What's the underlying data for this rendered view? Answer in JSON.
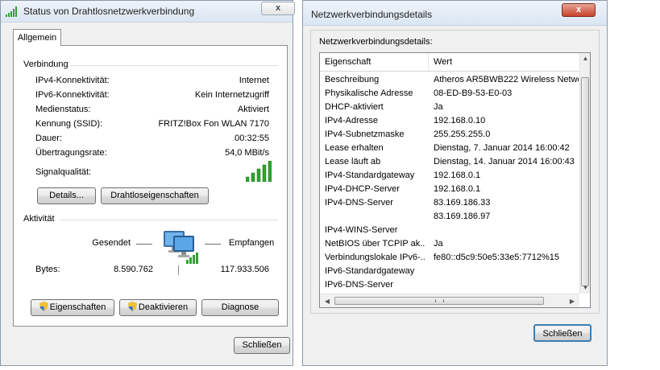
{
  "status_window": {
    "title": "Status von Drahtlosnetzwerkverbindung",
    "close_glyph": "x",
    "tab": "Allgemein",
    "connection_group": "Verbindung",
    "rows": [
      {
        "label": "IPv4-Konnektivität:",
        "value": "Internet"
      },
      {
        "label": "IPv6-Konnektivität:",
        "value": "Kein Internetzugriff"
      },
      {
        "label": "Medienstatus:",
        "value": "Aktiviert"
      },
      {
        "label": "Kennung (SSID):",
        "value": "FRITZ!Box Fon WLAN 7170"
      },
      {
        "label": "Dauer:",
        "value": "00:32:55"
      },
      {
        "label": "Übertragungsrate:",
        "value": "54,0 MBit/s"
      }
    ],
    "signal_label": "Signalqualität:",
    "signal_bars_lit": 5,
    "signal_bars_total": 5,
    "details_button": "Details...",
    "wireless_props_button": "Drahtloseigenschaften",
    "activity_group": "Aktivität",
    "sent_label": "Gesendet",
    "received_label": "Empfangen",
    "bytes_label": "Bytes:",
    "bytes_sent": "8.590.762",
    "bytes_received": "117.933.506",
    "properties_button": "Eigenschaften",
    "deactivate_button": "Deaktivieren",
    "diagnose_button": "Diagnose",
    "close_button": "Schließen",
    "colors": {
      "signal": "#2fa32f",
      "monitor": "#2b7fd6"
    },
    "icons": {
      "title": "wireless-signal-icon",
      "shield": "uac-shield-icon",
      "network": "network-computer-icon"
    }
  },
  "details_window": {
    "title": "Netzwerkverbindungsdetails",
    "close_glyph": "x",
    "heading": "Netzwerkverbindungsdetails:",
    "columns": [
      "Eigenschaft",
      "Wert"
    ],
    "rows": [
      {
        "property": "Beschreibung",
        "value": "Atheros AR5BWB222 Wireless Netwo"
      },
      {
        "property": "Physikalische Adresse",
        "value": "08-ED-B9-53-E0-03"
      },
      {
        "property": "DHCP-aktiviert",
        "value": "Ja"
      },
      {
        "property": "IPv4-Adresse",
        "value": "192.168.0.10"
      },
      {
        "property": "IPv4-Subnetzmaske",
        "value": "255.255.255.0"
      },
      {
        "property": "Lease erhalten",
        "value": "Dienstag, 7. Januar 2014 16:00:42"
      },
      {
        "property": "Lease läuft ab",
        "value": "Dienstag, 14. Januar 2014 16:00:43"
      },
      {
        "property": "IPv4-Standardgateway",
        "value": "192.168.0.1"
      },
      {
        "property": "IPv4-DHCP-Server",
        "value": "192.168.0.1"
      },
      {
        "property": "IPv4-DNS-Server",
        "value": "83.169.186.33"
      },
      {
        "property": "",
        "value": "83.169.186.97"
      },
      {
        "property": "IPv4-WINS-Server",
        "value": ""
      },
      {
        "property": "NetBIOS über TCPIP ak...",
        "value": "Ja"
      },
      {
        "property": "Verbindungslokale IPv6-...",
        "value": "fe80::d5c9:50e5:33e5:7712%15"
      },
      {
        "property": "IPv6-Standardgateway",
        "value": ""
      },
      {
        "property": "IPv6-DNS-Server",
        "value": ""
      }
    ],
    "close_button": "Schließen",
    "colors": {
      "close_red": "#c7432c",
      "focus_border": "#3c7fb1"
    }
  }
}
